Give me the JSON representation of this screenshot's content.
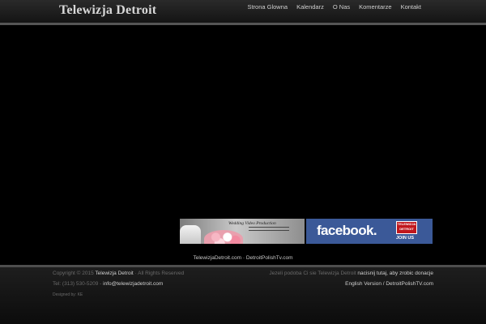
{
  "header": {
    "logo": "Telewizja Detroit",
    "nav": [
      "Strona Glowna",
      "Kalendarz",
      "O Nas",
      "Komentarze",
      "Kontakt"
    ]
  },
  "banners": {
    "wedding": {
      "title": "Wedding Video Production"
    },
    "facebook": {
      "text": "facebook.",
      "badge": "TELEWIZJA DETROIT",
      "join": "JOIN US"
    }
  },
  "links": {
    "site1": "TelewizjaDetroit.com",
    "separator": "·",
    "site2": "DetroitPolishTv.com"
  },
  "footer": {
    "copyright_prefix": "Copyright © 2015",
    "copyright_brand": "Telewizja Detroit",
    "copyright_suffix": "· All Rights Reserved",
    "phone": "Tel: (313) 530-5209 -",
    "email": "info@telewizjadetroit.com",
    "designed_by": "Designed by: KE",
    "donate_prefix": "Jezeli podoba Ci sie Telewizja Detroit",
    "donate_link": "nacisnij tutaj, aby zrobic donacje",
    "english_version": "English Version / DetroitPolishTV.com"
  },
  "colors": {
    "background": "#000000",
    "facebook_blue": "#3b5998",
    "badge_red": "#c0171d"
  }
}
